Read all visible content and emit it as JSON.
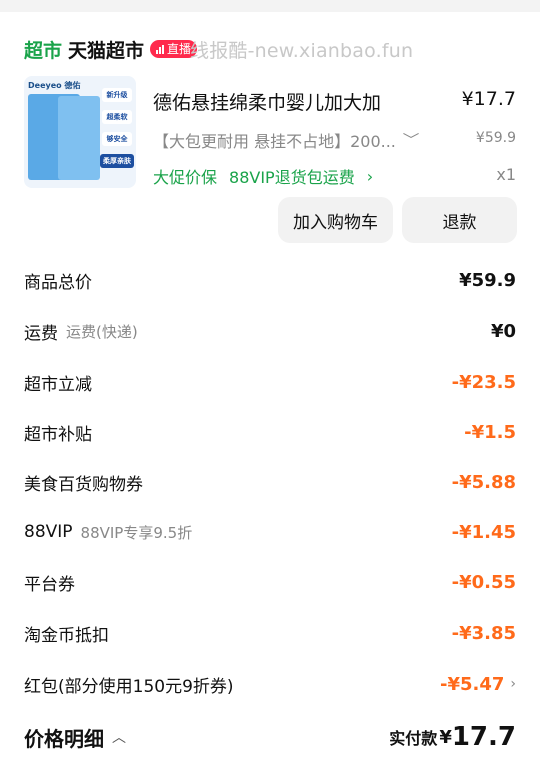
{
  "store": {
    "badge": "超市",
    "name": "天猫超市",
    "live_label": "直播",
    "watermark": "线报酷-new.xianbao.fun"
  },
  "product": {
    "thumb_brand": "Deeyeo 德佑",
    "thumb_tags": [
      "新升级",
      "超柔软",
      "够安全",
      "柔厚亲肤"
    ],
    "title": "德佑悬挂绵柔巾婴儿加大加",
    "price": "¥17.7",
    "spec": "【大包更耐用 悬挂不占地】200...",
    "original_price": "¥59.9",
    "promo_1": "大促价保",
    "promo_2": "88VIP退货包运费",
    "qty": "x1"
  },
  "actions": {
    "add_to_cart": "加入购物车",
    "refund": "退款"
  },
  "breakdown": [
    {
      "label": "商品总价",
      "sub": "",
      "value": "¥59.9"
    },
    {
      "label": "运费",
      "sub": "运费(快递)",
      "value": "¥0"
    },
    {
      "label": "超市立减",
      "sub": "",
      "value": "-¥23.5"
    },
    {
      "label": "超市补贴",
      "sub": "",
      "value": "-¥1.5"
    },
    {
      "label": "美食百货购物券",
      "sub": "",
      "value": "-¥5.88"
    },
    {
      "label": "88VIP",
      "sub": "88VIP专享9.5折",
      "value": "-¥1.45"
    },
    {
      "label": "平台券",
      "sub": "",
      "value": "-¥0.55"
    },
    {
      "label": "淘金币抵扣",
      "sub": "",
      "value": "-¥3.85"
    },
    {
      "label": "红包(部分使用150元9折券)",
      "sub": "",
      "value": "-¥5.47"
    }
  ],
  "summary": {
    "title": "价格明细",
    "paid_label": "实付款",
    "paid_currency": "¥",
    "paid_amount": "17.7"
  },
  "colors": {
    "green": "#1aa34a",
    "discount_orange": "#ff6a1a",
    "live_red": "#ff2a4d"
  }
}
